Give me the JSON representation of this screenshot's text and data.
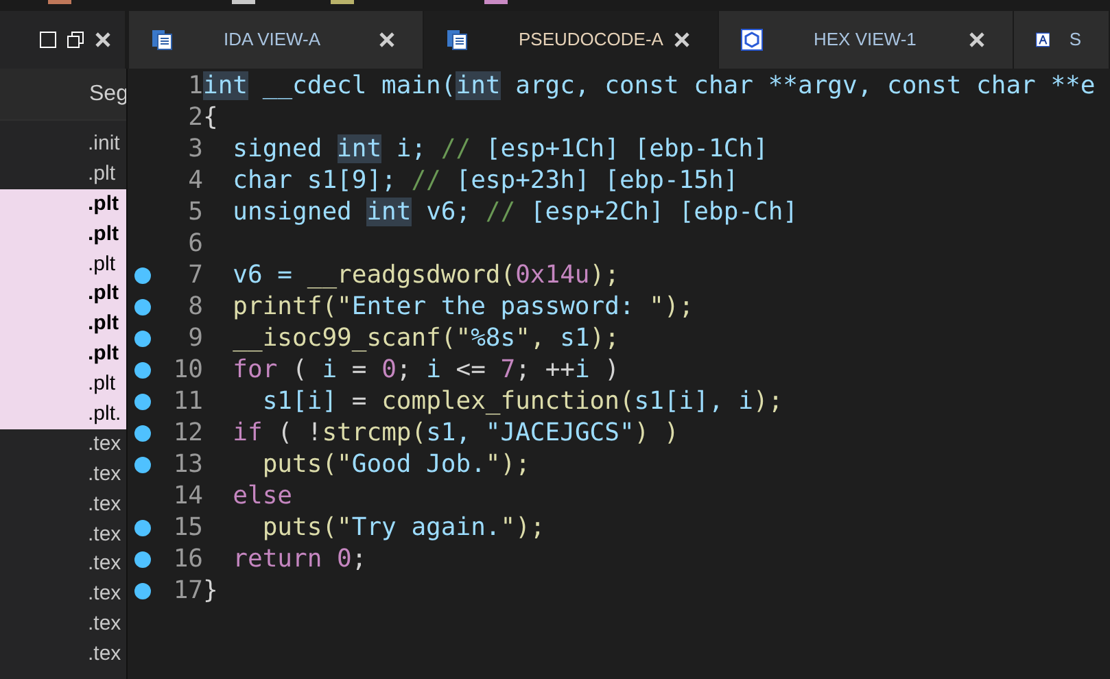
{
  "tabs": [
    {
      "label": "IDA VIEW-A",
      "kind": "listing",
      "selected": false
    },
    {
      "label": "PSEUDOCODE-A",
      "kind": "listing",
      "selected": true
    },
    {
      "label": "HEX VIEW-1",
      "kind": "hex",
      "selected": false
    },
    {
      "label": "S",
      "kind": "struct",
      "selected": false
    }
  ],
  "segments": {
    "header": "Seg",
    "rows": [
      {
        "text": ".init",
        "highlighted": false,
        "bold": false
      },
      {
        "text": ".plt",
        "highlighted": false,
        "bold": false
      },
      {
        "text": ".plt",
        "highlighted": true,
        "bold": true
      },
      {
        "text": ".plt",
        "highlighted": true,
        "bold": true
      },
      {
        "text": ".plt",
        "highlighted": true,
        "bold": false
      },
      {
        "text": ".plt",
        "highlighted": true,
        "bold": true
      },
      {
        "text": ".plt",
        "highlighted": true,
        "bold": true
      },
      {
        "text": ".plt",
        "highlighted": true,
        "bold": true
      },
      {
        "text": ".plt",
        "highlighted": true,
        "bold": false
      },
      {
        "text": ".plt.",
        "highlighted": true,
        "bold": false
      },
      {
        "text": ".tex",
        "highlighted": false,
        "bold": false
      },
      {
        "text": ".tex",
        "highlighted": false,
        "bold": false
      },
      {
        "text": ".tex",
        "highlighted": false,
        "bold": false
      },
      {
        "text": ".tex",
        "highlighted": false,
        "bold": false
      },
      {
        "text": ".tex",
        "highlighted": false,
        "bold": false
      },
      {
        "text": ".tex",
        "highlighted": false,
        "bold": false
      },
      {
        "text": ".tex",
        "highlighted": false,
        "bold": false
      },
      {
        "text": ".tex",
        "highlighted": false,
        "bold": false
      }
    ]
  },
  "code": [
    {
      "number": "1",
      "breakpoint": false,
      "tokens": [
        {
          "kind": "hl",
          "text": "int"
        },
        {
          "kind": "id",
          "text": " __cdecl main("
        },
        {
          "kind": "hl",
          "text": "int"
        },
        {
          "kind": "id",
          "text": " argc, const char **argv, const char **e"
        }
      ]
    },
    {
      "number": "2",
      "breakpoint": false,
      "tokens": [
        {
          "kind": "punc",
          "text": "{"
        }
      ]
    },
    {
      "number": "3",
      "breakpoint": false,
      "tokens": [
        {
          "kind": "id",
          "text": "  signed "
        },
        {
          "kind": "hl",
          "text": "int"
        },
        {
          "kind": "id",
          "text": " i; "
        },
        {
          "kind": "cm",
          "text": "//"
        },
        {
          "kind": "id",
          "text": " [esp+1Ch] [ebp-1Ch]"
        }
      ]
    },
    {
      "number": "4",
      "breakpoint": false,
      "tokens": [
        {
          "kind": "id",
          "text": "  char s1[9]; "
        },
        {
          "kind": "cm",
          "text": "//"
        },
        {
          "kind": "id",
          "text": " [esp+23h] [ebp-15h]"
        }
      ]
    },
    {
      "number": "5",
      "breakpoint": false,
      "tokens": [
        {
          "kind": "id",
          "text": "  unsigned "
        },
        {
          "kind": "hl",
          "text": "int"
        },
        {
          "kind": "id",
          "text": " v6; "
        },
        {
          "kind": "cm",
          "text": "//"
        },
        {
          "kind": "id",
          "text": " [esp+2Ch] [ebp-Ch]"
        }
      ]
    },
    {
      "number": "6",
      "breakpoint": false
    },
    {
      "number": "7",
      "breakpoint": true,
      "tokens": [
        {
          "kind": "id",
          "text": "  v6 = "
        },
        {
          "kind": "fn",
          "text": "__readgsdword("
        },
        {
          "kind": "num",
          "text": "0x14u"
        },
        {
          "kind": "fn",
          "text": ");"
        }
      ]
    },
    {
      "number": "8",
      "breakpoint": true,
      "tokens": [
        {
          "kind": "fn",
          "text": "  printf(\""
        },
        {
          "kind": "id",
          "text": "Enter the password: "
        },
        {
          "kind": "fn",
          "text": "\");"
        }
      ]
    },
    {
      "number": "9",
      "breakpoint": true,
      "tokens": [
        {
          "kind": "fn",
          "text": "  __isoc99_scanf(\""
        },
        {
          "kind": "id",
          "text": "%8s"
        },
        {
          "kind": "fn",
          "text": "\", "
        },
        {
          "kind": "id",
          "text": "s1"
        },
        {
          "kind": "fn",
          "text": ");"
        }
      ]
    },
    {
      "number": "10",
      "breakpoint": true,
      "tokens": [
        {
          "kind": "kw",
          "text": "  for"
        },
        {
          "kind": "punc",
          "text": " ( "
        },
        {
          "kind": "id",
          "text": "i"
        },
        {
          "kind": "punc",
          "text": " = "
        },
        {
          "kind": "num",
          "text": "0"
        },
        {
          "kind": "punc",
          "text": "; "
        },
        {
          "kind": "id",
          "text": "i"
        },
        {
          "kind": "punc",
          "text": " <= "
        },
        {
          "kind": "num",
          "text": "7"
        },
        {
          "kind": "punc",
          "text": "; ++"
        },
        {
          "kind": "id",
          "text": "i"
        },
        {
          "kind": "punc",
          "text": " )"
        }
      ]
    },
    {
      "number": "11",
      "breakpoint": true,
      "tokens": [
        {
          "kind": "id",
          "text": "    s1[i]"
        },
        {
          "kind": "punc",
          "text": " = "
        },
        {
          "kind": "fn",
          "text": "complex_function("
        },
        {
          "kind": "id",
          "text": "s1[i], i"
        },
        {
          "kind": "fn",
          "text": ");"
        }
      ]
    },
    {
      "number": "12",
      "breakpoint": true,
      "tokens": [
        {
          "kind": "kw",
          "text": "  if"
        },
        {
          "kind": "punc",
          "text": " ( !"
        },
        {
          "kind": "fn",
          "text": "strcmp("
        },
        {
          "kind": "id",
          "text": "s1, \"JACEJGCS\""
        },
        {
          "kind": "fn",
          "text": ") )"
        }
      ]
    },
    {
      "number": "13",
      "breakpoint": true,
      "tokens": [
        {
          "kind": "fn",
          "text": "    puts(\""
        },
        {
          "kind": "id",
          "text": "Good Job."
        },
        {
          "kind": "fn",
          "text": "\");"
        }
      ]
    },
    {
      "number": "14",
      "breakpoint": false,
      "tokens": [
        {
          "kind": "kw",
          "text": "  else"
        }
      ]
    },
    {
      "number": "15",
      "breakpoint": true,
      "tokens": [
        {
          "kind": "fn",
          "text": "    puts(\""
        },
        {
          "kind": "id",
          "text": "Try again."
        },
        {
          "kind": "fn",
          "text": "\");"
        }
      ]
    },
    {
      "number": "16",
      "breakpoint": true,
      "tokens": [
        {
          "kind": "kw",
          "text": "  return "
        },
        {
          "kind": "num",
          "text": "0"
        },
        {
          "kind": "punc",
          "text": ";"
        }
      ]
    },
    {
      "number": "17",
      "breakpoint": true,
      "tokens": [
        {
          "kind": "punc",
          "text": "}"
        }
      ]
    }
  ]
}
